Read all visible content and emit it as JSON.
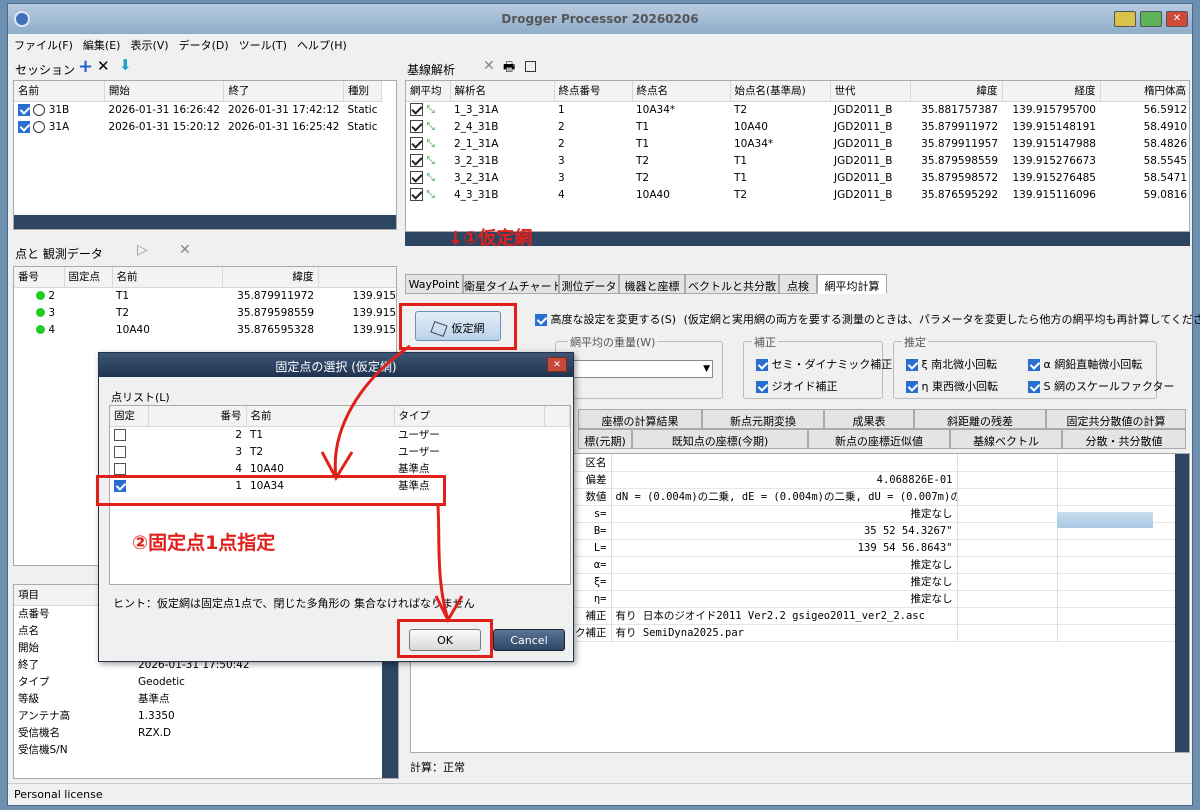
{
  "window": {
    "title": "Drogger Processor 20260206"
  },
  "menu": [
    "ファイル(F)",
    "編集(E)",
    "表示(V)",
    "データ(D)",
    "ツール(T)",
    "ヘルプ(H)"
  ],
  "session": {
    "title": "セッション",
    "columns": [
      "名前",
      "開始",
      "終了",
      "種別"
    ],
    "rows": [
      {
        "name": "31B",
        "start": "2026-01-31 16:26:42",
        "end": "2026-01-31 17:42:12",
        "type": "Static"
      },
      {
        "name": "31A",
        "start": "2026-01-31 15:20:12",
        "end": "2026-01-31 16:25:42",
        "type": "Static"
      }
    ]
  },
  "points": {
    "title": "点と 観測データ",
    "columns": [
      "番号",
      "固定点",
      "名前",
      "緯度",
      "経度"
    ],
    "rows": [
      {
        "no": "2",
        "name": "T1",
        "lat": "35.879911972",
        "lon": "139.91514819"
      },
      {
        "no": "3",
        "name": "T2",
        "lat": "35.879598559",
        "lon": "139.91527667"
      },
      {
        "no": "4",
        "name": "10A40",
        "lat": "35.876595328",
        "lon": "139.91511609"
      }
    ]
  },
  "props": {
    "header": "項目",
    "rows": [
      {
        "k": "点番号",
        "v": ""
      },
      {
        "k": "点名",
        "v": ""
      },
      {
        "k": "開始",
        "v": ""
      },
      {
        "k": "終了",
        "v": "2026-01-31 17:50:42"
      },
      {
        "k": "タイプ",
        "v": "Geodetic"
      },
      {
        "k": "等級",
        "v": "基準点"
      },
      {
        "k": "アンテナ高",
        "v": "1.3350"
      },
      {
        "k": "受信機名",
        "v": "RZX.D"
      },
      {
        "k": "受信機S/N",
        "v": ""
      }
    ]
  },
  "baseline": {
    "title": "基線解析",
    "columns": [
      "網平均",
      "解析名",
      "終点番号",
      "終点名",
      "始点名(基準局)",
      "世代",
      "緯度",
      "経度",
      "楕円体高"
    ],
    "rows": [
      {
        "name": "1_3_31A",
        "endno": "1",
        "endname": "10A34*",
        "start": "T2",
        "gen": "JGD2011_B",
        "lat": "35.881757387",
        "lon": "139.915795700",
        "h": "56.5912"
      },
      {
        "name": "2_4_31B",
        "endno": "2",
        "endname": "T1",
        "start": "10A40",
        "gen": "JGD2011_B",
        "lat": "35.879911972",
        "lon": "139.915148191",
        "h": "58.4910"
      },
      {
        "name": "2_1_31A",
        "endno": "2",
        "endname": "T1",
        "start": "10A34*",
        "gen": "JGD2011_B",
        "lat": "35.879911957",
        "lon": "139.915147988",
        "h": "58.4826"
      },
      {
        "name": "3_2_31B",
        "endno": "3",
        "endname": "T2",
        "start": "T1",
        "gen": "JGD2011_B",
        "lat": "35.879598559",
        "lon": "139.915276673",
        "h": "58.5545"
      },
      {
        "name": "3_2_31A",
        "endno": "3",
        "endname": "T2",
        "start": "T1",
        "gen": "JGD2011_B",
        "lat": "35.879598572",
        "lon": "139.915276485",
        "h": "58.5471"
      },
      {
        "name": "4_3_31B",
        "endno": "4",
        "endname": "10A40",
        "start": "T2",
        "gen": "JGD2011_B",
        "lat": "35.876595292",
        "lon": "139.915116096",
        "h": "59.0816"
      }
    ]
  },
  "annotations": {
    "step1": "↓①仮定網",
    "step2": "②固定点1点指定"
  },
  "tabs": [
    "WayPoint",
    "衛星タイムチャート",
    "測位データ",
    "機器と座標",
    "ベクトルと共分散",
    "点検",
    "網平均計算"
  ],
  "adjust": {
    "button": "仮定網",
    "advanced": "高度な設定を変更する(S)",
    "advanced_note": "(仮定網と実用網の両方を要する測量のときは、パラメータを変更したら他方の網平均も再計算してください。)",
    "weight_group": "網平均の重量(W)",
    "weight_value": "値",
    "correction_group": "補正",
    "corr1": "セミ・ダイナミック補正",
    "corr2": "ジオイド補正",
    "estimate_group": "推定",
    "est1": "ξ 南北微小回転",
    "est2": "η 東西微小回転",
    "est3": "α 網鉛直軸微小回転",
    "est4": "S 網のスケールファクター"
  },
  "subtabs_row1": [
    "座標の計算結果",
    "新点元期変換",
    "成果表",
    "斜距離の残差",
    "固定共分散値の計算"
  ],
  "subtabs_row2": [
    "標(元期)",
    "既知点の座標(今期)",
    "新点の座標近似値",
    "基線ベクトル",
    "分散・共分散値"
  ],
  "results": [
    {
      "k": "区名",
      "v": ""
    },
    {
      "k": "偏差",
      "v": "4.068826E-01"
    },
    {
      "k": "数値",
      "v": "dN = (0.004m)の二乗, dE = (0.004m)の二乗, dU = (0.007m)の"
    },
    {
      "k": "s=",
      "v": "推定なし"
    },
    {
      "k": "B=",
      "v": "35 52 54.3267\""
    },
    {
      "k": "L=",
      "v": "139 54 56.8643\""
    },
    {
      "k": "α=",
      "v": "推定なし"
    },
    {
      "k": "ξ=",
      "v": "推定なし"
    },
    {
      "k": "η=",
      "v": "推定なし"
    },
    {
      "k": "補正",
      "v": "有り 日本のジオイド2011 Ver2.2   gsigeo2011_ver2_2.asc"
    },
    {
      "k": "セミ・ダイナミック補正",
      "v": "有り SemiDyna2025.par"
    }
  ],
  "calc_status": "計算：正常",
  "status_bar": "Personal license",
  "dialog": {
    "title": "固定点の選択 (仮定網)",
    "list_label": "点リスト(L)",
    "columns": [
      "固定",
      "番号",
      "名前",
      "タイプ"
    ],
    "rows": [
      {
        "fixed": false,
        "no": "2",
        "name": "T1",
        "type": "ユーザー"
      },
      {
        "fixed": false,
        "no": "3",
        "name": "T2",
        "type": "ユーザー"
      },
      {
        "fixed": false,
        "no": "4",
        "name": "10A40",
        "type": "基準点"
      },
      {
        "fixed": true,
        "no": "1",
        "name": "10A34",
        "type": "基準点"
      }
    ],
    "hint": "ヒント：仮定網は固定点1点で、閉じた多角形の 集合なければなりません",
    "ok": "OK",
    "cancel": "Cancel"
  }
}
